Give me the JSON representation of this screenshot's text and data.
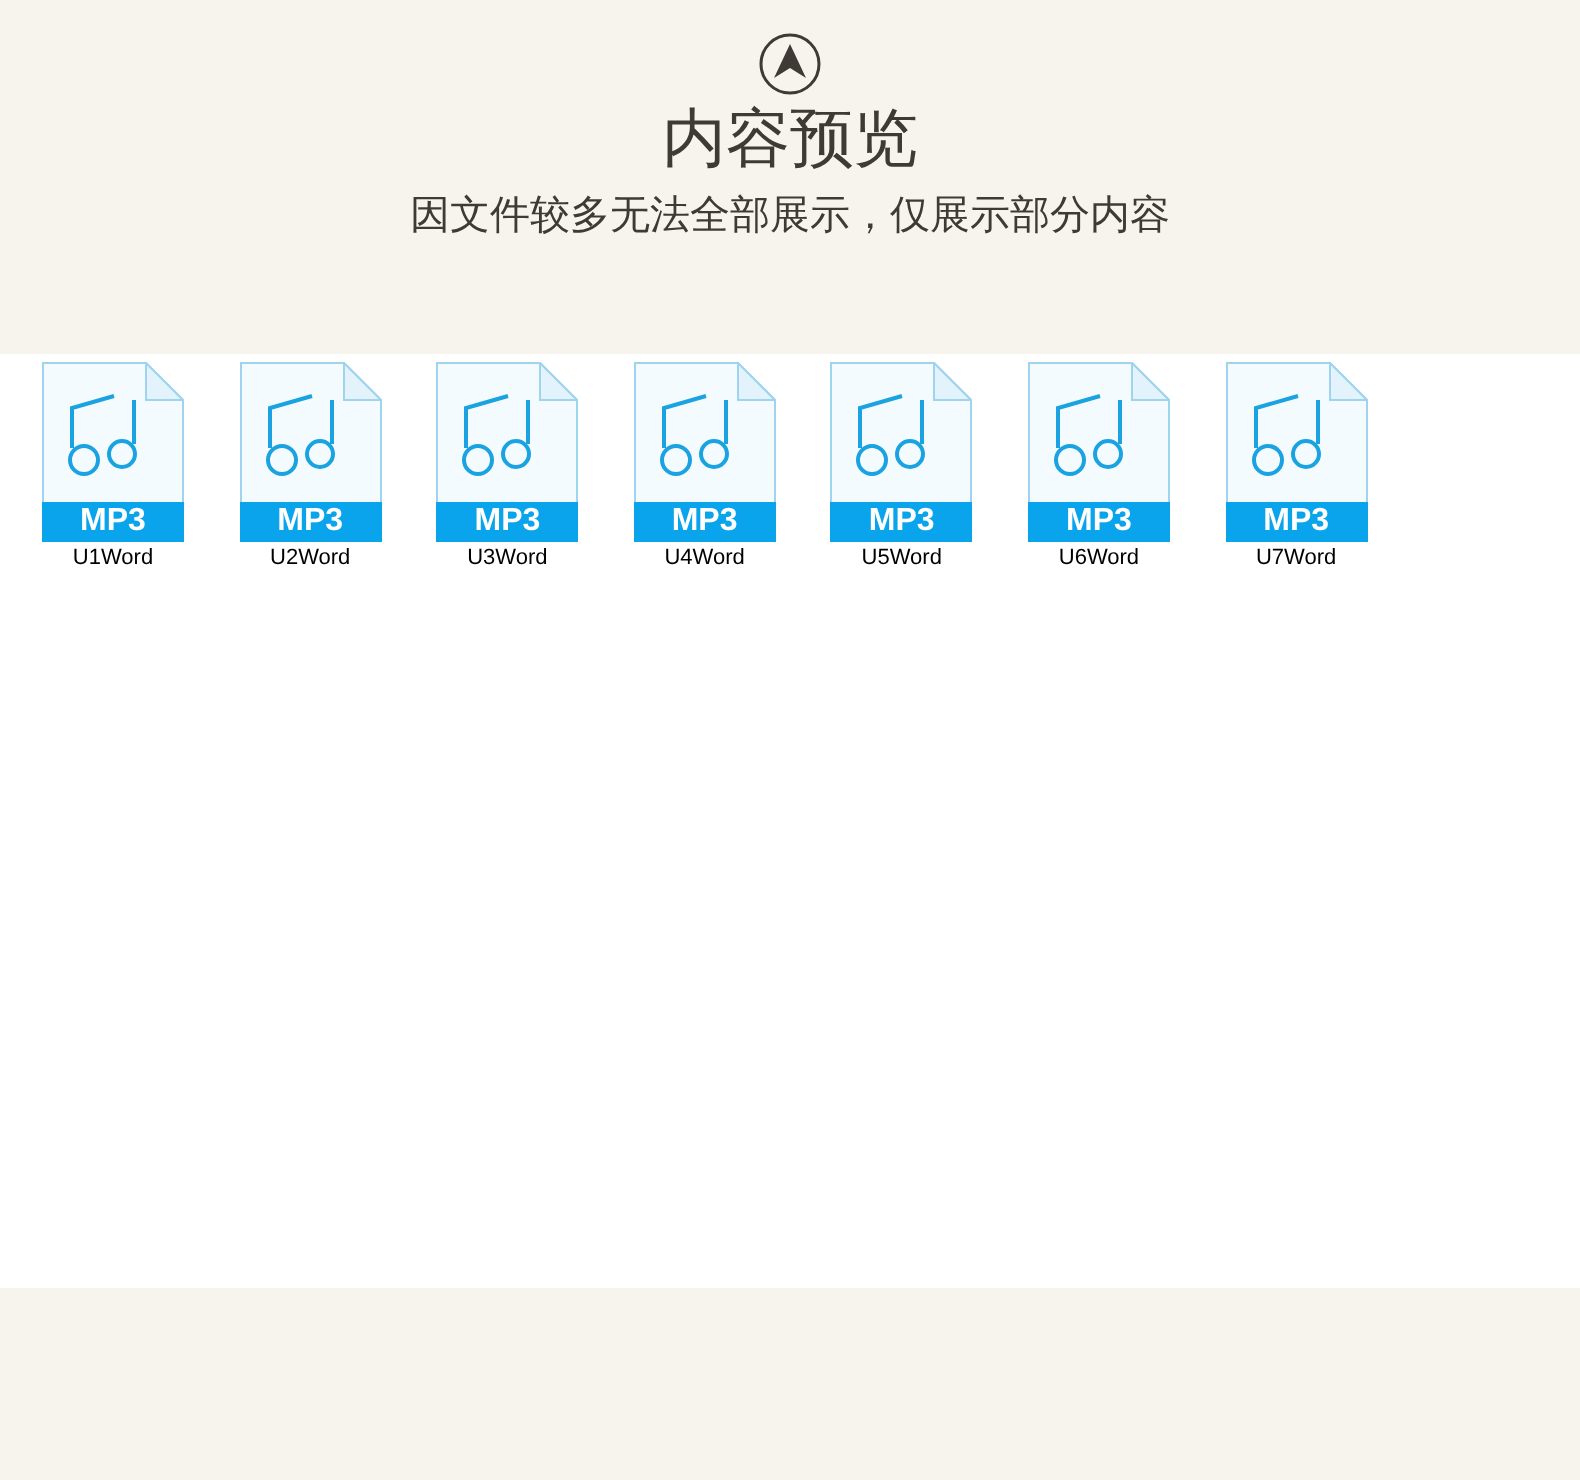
{
  "header": {
    "title": "内容预览",
    "subtitle": "因文件较多无法全部展示，仅展示部分内容"
  },
  "files": [
    {
      "type_label": "MP3",
      "name": "U1Word"
    },
    {
      "type_label": "MP3",
      "name": "U2Word"
    },
    {
      "type_label": "MP3",
      "name": "U3Word"
    },
    {
      "type_label": "MP3",
      "name": "U4Word"
    },
    {
      "type_label": "MP3",
      "name": "U5Word"
    },
    {
      "type_label": "MP3",
      "name": "U6Word"
    },
    {
      "type_label": "MP3",
      "name": "U7Word"
    }
  ]
}
